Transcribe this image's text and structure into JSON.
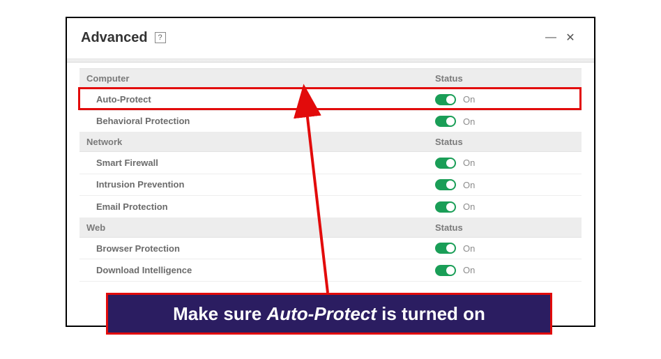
{
  "window": {
    "title": "Advanced",
    "help_glyph": "?",
    "minimize_glyph": "—",
    "close_glyph": "✕"
  },
  "columns": {
    "category": "",
    "status_header": "Status"
  },
  "sections": [
    {
      "name": "Computer",
      "items": [
        {
          "label": "Auto-Protect",
          "status": "On",
          "on": true,
          "highlight": true
        },
        {
          "label": "Behavioral Protection",
          "status": "On",
          "on": true
        }
      ]
    },
    {
      "name": "Network",
      "items": [
        {
          "label": "Smart Firewall",
          "status": "On",
          "on": true
        },
        {
          "label": "Intrusion Prevention",
          "status": "On",
          "on": true
        },
        {
          "label": "Email Protection",
          "status": "On",
          "on": true
        }
      ]
    },
    {
      "name": "Web",
      "items": [
        {
          "label": "Browser Protection",
          "status": "On",
          "on": true
        },
        {
          "label": "Download Intelligence",
          "status": "On",
          "on": true
        }
      ]
    }
  ],
  "annotation": {
    "caption_prefix": "Make sure ",
    "caption_em": "Auto-Protect",
    "caption_suffix": " is turned on"
  }
}
